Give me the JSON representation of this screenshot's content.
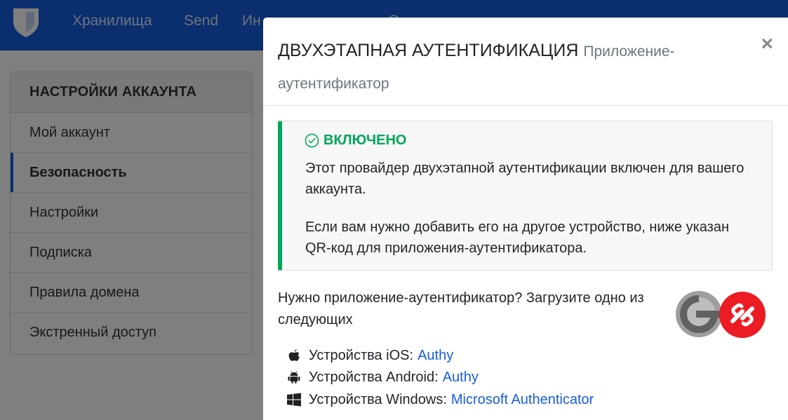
{
  "navbar": {
    "items": [
      "Хранилища",
      "Send",
      "Ин",
      "О"
    ]
  },
  "sidebar": {
    "title": "НАСТРОЙКИ АККАУНТА",
    "items": [
      {
        "label": "Мой аккаунт"
      },
      {
        "label": "Безопасность"
      },
      {
        "label": "Настройки"
      },
      {
        "label": "Подписка"
      },
      {
        "label": "Правила домена"
      },
      {
        "label": "Экстренный доступ"
      }
    ]
  },
  "modal": {
    "title": "ДВУХЭТАПНАЯ АУТЕНТИФИКАЦИЯ",
    "subtitle": "Приложение-аутентификатор",
    "close_symbol": "×",
    "status_label": "ВКЛЮЧЕНО",
    "paragraph1": "Этот провайдер двухэтапной аутентификации включен для вашего аккаунта.",
    "paragraph2": "Если вам нужно добавить его на другое устройство, ниже указан QR-код для приложения-аутентификатора.",
    "need_app_text": "Нужно приложение-аутентификатор? Загрузите одно из следующих",
    "platforms": [
      {
        "label": "Устройства iOS:",
        "link": "Authy",
        "icon": "apple-icon"
      },
      {
        "label": "Устройства Android:",
        "link": "Authy",
        "icon": "android-icon"
      },
      {
        "label": "Устройства Windows:",
        "link": "Microsoft Authenticator",
        "icon": "windows-icon"
      }
    ]
  },
  "colors": {
    "brand": "#175ddc",
    "success": "#00a65a",
    "authy_red": "#ec1c24"
  }
}
